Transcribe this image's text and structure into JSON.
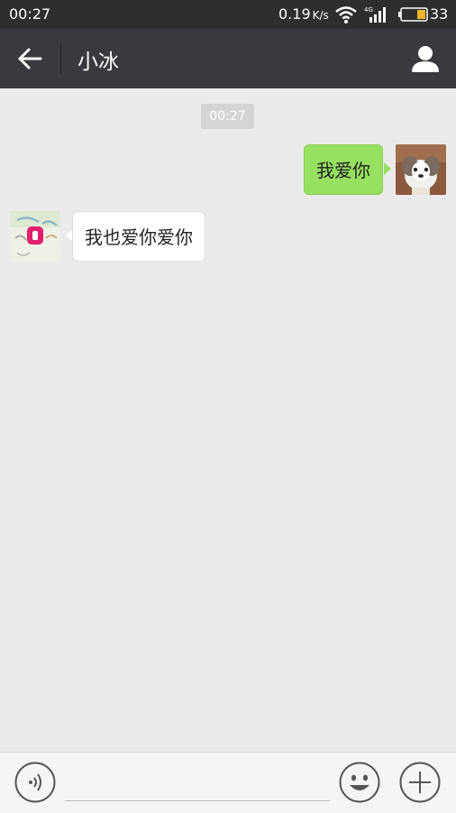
{
  "status_bar": {
    "time": "00:27",
    "speed_value": "0.19",
    "speed_unit": "K/s",
    "network_label": "4G",
    "battery_percent": "33"
  },
  "header": {
    "title": "小冰",
    "back_icon": "arrow-left-icon",
    "profile_icon": "person-icon"
  },
  "chat": {
    "timestamp": "00:27",
    "messages": [
      {
        "direction": "outgoing",
        "text": "我爱你",
        "avatar": "puppy-photo"
      },
      {
        "direction": "incoming",
        "text": "我也爱你爱你",
        "avatar": "xiaoice-avatar"
      }
    ]
  },
  "input_bar": {
    "voice_icon": "voice-icon",
    "input_value": "",
    "emoji_icon": "emoji-icon",
    "plus_icon": "plus-icon"
  },
  "colors": {
    "status_bar": "#2e2e2e",
    "header": "#393a3f",
    "chat_bg": "#ebebeb",
    "outgoing_bubble": "#97e061",
    "incoming_bubble": "#ffffff"
  }
}
